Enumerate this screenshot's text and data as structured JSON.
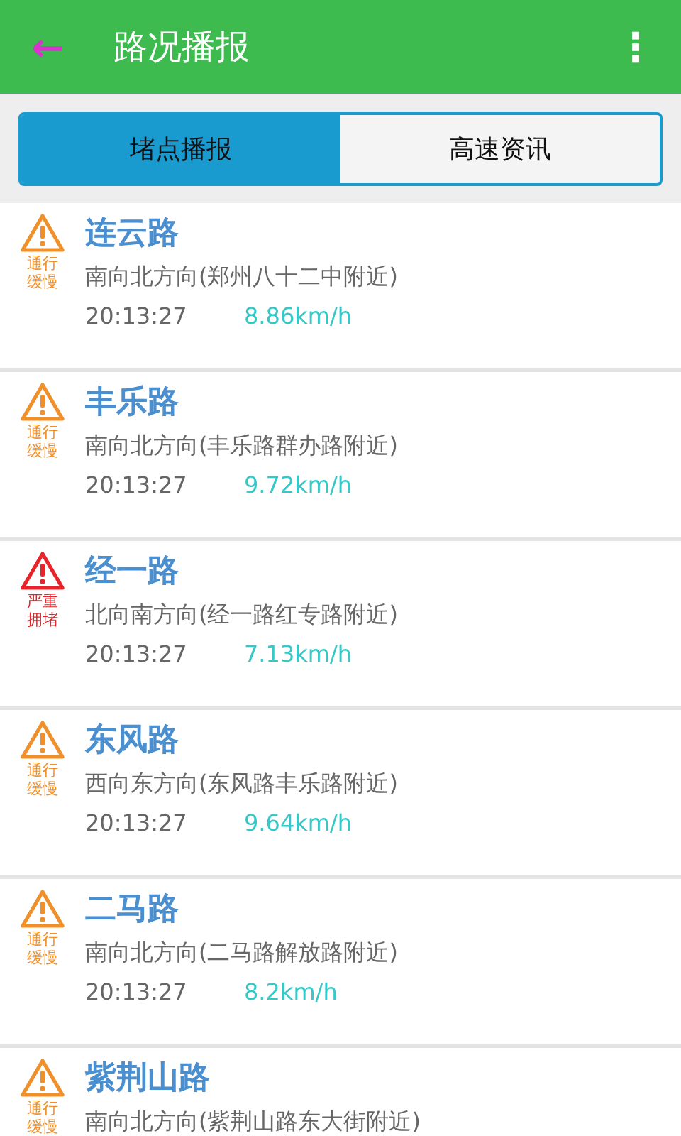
{
  "header": {
    "back_icon": "←",
    "title": "路况播报",
    "menu_icon": "⋮"
  },
  "tabs": [
    {
      "label": "堵点播报",
      "selected": true
    },
    {
      "label": "高速资讯",
      "selected": false
    }
  ],
  "items": [
    {
      "kind": "slow",
      "status": "通行缓慢",
      "road": "连云路",
      "direction": "南向北方向(郑州八十二中附近)",
      "time": "20:13:27",
      "speed": "8.86km/h"
    },
    {
      "kind": "slow",
      "status": "通行缓慢",
      "road": "丰乐路",
      "direction": "南向北方向(丰乐路群办路附近)",
      "time": "20:13:27",
      "speed": "9.72km/h"
    },
    {
      "kind": "jam",
      "status": "严重拥堵",
      "road": "经一路",
      "direction": "北向南方向(经一路红专路附近)",
      "time": "20:13:27",
      "speed": "7.13km/h"
    },
    {
      "kind": "slow",
      "status": "通行缓慢",
      "road": "东风路",
      "direction": "西向东方向(东风路丰乐路附近)",
      "time": "20:13:27",
      "speed": "9.64km/h"
    },
    {
      "kind": "slow",
      "status": "通行缓慢",
      "road": "二马路",
      "direction": "南向北方向(二马路解放路附近)",
      "time": "20:13:27",
      "speed": "8.2km/h"
    },
    {
      "kind": "slow",
      "status": "通行缓慢",
      "road": "紫荆山路",
      "direction": "南向北方向(紫荆山路东大街附近)"
    }
  ]
}
